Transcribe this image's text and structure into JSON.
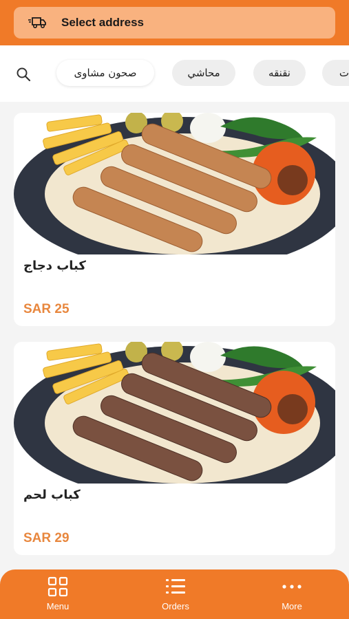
{
  "header": {
    "address_label": "Select address",
    "icon": "delivery-truck-icon"
  },
  "categories": {
    "search_icon": "search-icon",
    "items": [
      {
        "label": "صحون مشاوى",
        "active": true
      },
      {
        "label": "محاشي",
        "active": false
      },
      {
        "label": "نقنقه",
        "active": false
      },
      {
        "label": "ت",
        "active": false
      }
    ]
  },
  "products": [
    {
      "name": "كباب دجاج",
      "price": "SAR 25"
    },
    {
      "name": "كباب لحم",
      "price": "SAR 29"
    }
  ],
  "nav": {
    "items": [
      {
        "label": "Menu",
        "icon": "grid-icon"
      },
      {
        "label": "Orders",
        "icon": "list-icon"
      },
      {
        "label": "More",
        "icon": "dots-icon"
      }
    ]
  },
  "colors": {
    "accent": "#f07a28",
    "address_bar": "#f9b27f",
    "price": "#e8873e"
  }
}
